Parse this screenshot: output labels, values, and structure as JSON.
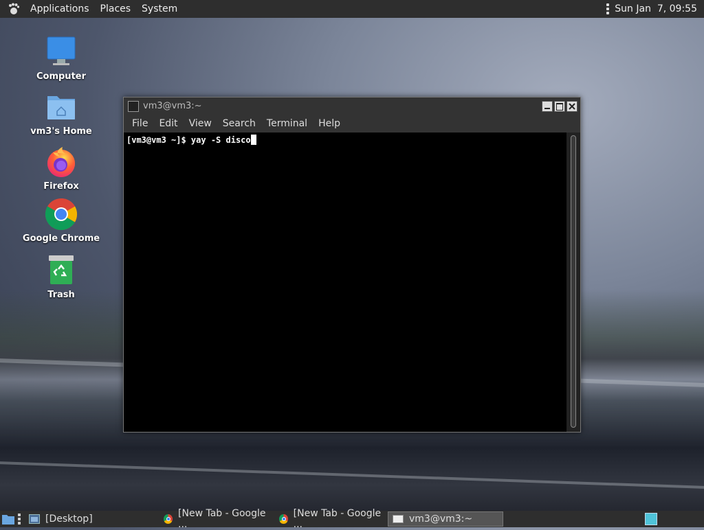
{
  "top_panel": {
    "menus": [
      "Applications",
      "Places",
      "System"
    ],
    "clock": "Sun Jan  7, 09:55"
  },
  "desktop_icons": [
    {
      "label": "Computer",
      "icon": "computer-icon"
    },
    {
      "label": "vm3's Home",
      "icon": "home-folder-icon"
    },
    {
      "label": "Firefox",
      "icon": "firefox-icon"
    },
    {
      "label": "Google Chrome",
      "icon": "chrome-icon"
    },
    {
      "label": "Trash",
      "icon": "trash-icon"
    }
  ],
  "terminal": {
    "title": "vm3@vm3:~",
    "menus": [
      "File",
      "Edit",
      "View",
      "Search",
      "Terminal",
      "Help"
    ],
    "line": "[vm3@vm3 ~]$ yay -S disco"
  },
  "taskbar": {
    "items": [
      {
        "label": "[Desktop]",
        "icon": "desktop-icon"
      },
      {
        "label": "[New Tab - Google ...",
        "icon": "chrome-icon"
      },
      {
        "label": "[New Tab - Google ...",
        "icon": "chrome-icon"
      },
      {
        "label": "vm3@vm3:~",
        "icon": "terminal-icon"
      }
    ]
  }
}
